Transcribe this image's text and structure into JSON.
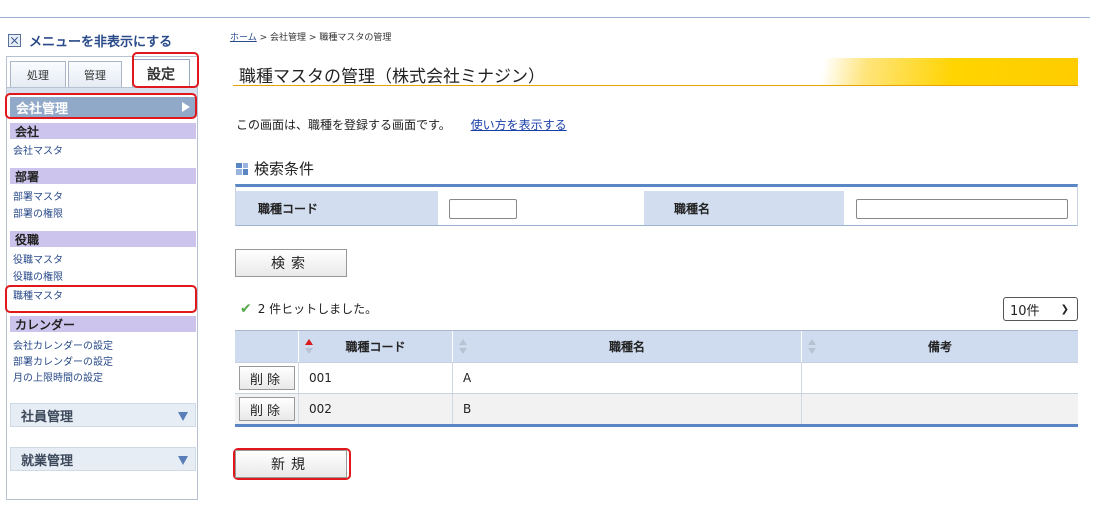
{
  "sidebar": {
    "hide_menu_label": "メニューを非表示にする",
    "tabs": [
      "処理",
      "管理",
      "設定"
    ],
    "section_title": "会社管理",
    "categories": [
      {
        "label": "会社",
        "items": [
          "会社マスタ"
        ]
      },
      {
        "label": "部署",
        "items": [
          "部署マスタ",
          "部署の権限"
        ]
      },
      {
        "label": "役職",
        "items": [
          "役職マスタ",
          "役職の権限",
          "職種マスタ"
        ]
      },
      {
        "label": "カレンダー",
        "items": [
          "会社カレンダーの設定",
          "部署カレンダーの設定",
          "月の上限時間の設定"
        ]
      }
    ],
    "collapsed": [
      "社員管理",
      "就業管理"
    ]
  },
  "breadcrumb": {
    "home": "ホーム",
    "sep1": ">",
    "level1": "会社管理",
    "sep2": ">",
    "level2": "職種マスタの管理"
  },
  "page_title": "職種マスタの管理（株式会社ミナジン）",
  "description": "この画面は、職種を登録する画面です。",
  "help_link": "使い方を表示する",
  "search": {
    "heading": "検索条件",
    "code_label": "職種コード",
    "name_label": "職種名",
    "code_value": "",
    "name_value": "",
    "button": "検索"
  },
  "results": {
    "hits_text": "2 件ヒットしました。",
    "page_size": "10件",
    "columns": [
      "",
      "職種コード",
      "職種名",
      "備考"
    ],
    "rows": [
      {
        "delete": "削除",
        "code": "001",
        "name": "A",
        "note": ""
      },
      {
        "delete": "削除",
        "code": "002",
        "name": "B",
        "note": ""
      }
    ],
    "new_button": "新規"
  },
  "colors": {
    "accent": "#5b86c5",
    "highlight": "#e0171b",
    "category_bg": "#ccc4ec",
    "title_stripe": "#ffd400"
  }
}
